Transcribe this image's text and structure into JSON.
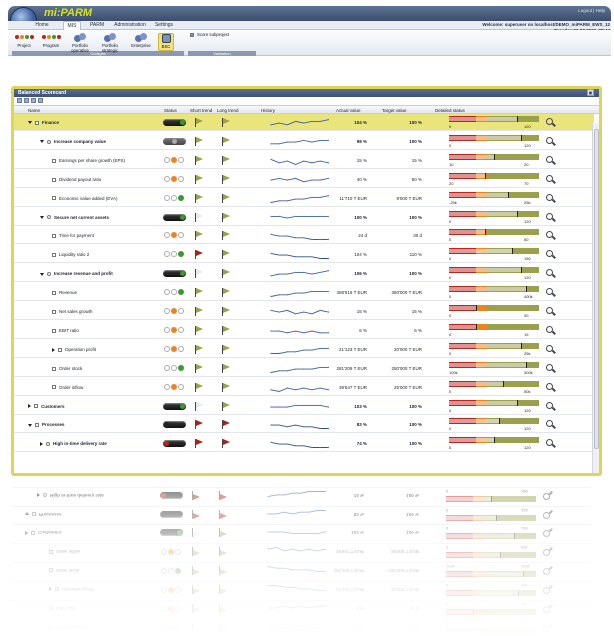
{
  "app": {
    "logo": "mi:PARM",
    "top_links": "Logout | Help"
  },
  "tabs": [
    "Home",
    "MIS",
    "PARM",
    "Administration",
    "Settings"
  ],
  "active_tab": "MIS",
  "welcome": {
    "line1": "Welcome: superuser  on localhost/DEMO_miPARM_EWS_12",
    "line2": "Tuesday 06.03.2012, 08:44"
  },
  "ribbon": {
    "cockpits": [
      "Project",
      "Program",
      "Portfolio operative",
      "Portfolio strategic",
      "Enterprise",
      "BSC"
    ],
    "cockpits_label": "Cockpits",
    "validation_item": "Score subproject",
    "validation_label": "Validation"
  },
  "panel": {
    "title": "Balanced Scorecard"
  },
  "columns": [
    "Name",
    "Status",
    "Short trend",
    "Long trend",
    "History",
    "Actual value",
    "Target value",
    "Detailed status"
  ],
  "rows": [
    {
      "name": "Finance",
      "level": 0,
      "bold": true,
      "hl": true,
      "status": "pill-green",
      "short": "olive",
      "long": "olive",
      "actual": "104 %",
      "target": "100 %",
      "min": "0",
      "max": "120",
      "fill": 0.75,
      "trend": [
        4,
        3,
        4,
        2,
        3,
        2,
        2,
        1
      ]
    },
    {
      "name": "Increase company value",
      "level": 1,
      "bold": true,
      "status": "pill-gray",
      "short": "olive",
      "long": "olive",
      "actual": "98 %",
      "target": "100 %",
      "min": "0",
      "max": "120",
      "fill": 0.8,
      "trend": [
        4,
        4,
        3,
        3,
        2,
        3,
        2,
        2
      ]
    },
    {
      "name": "Earnings per share growth (EPS)",
      "level": 2,
      "status": "lights-orange",
      "short": "olive",
      "long": "olive",
      "actual": "15 %",
      "target": "15 %",
      "min": "10",
      "max": "20",
      "fill": 0.5,
      "trend": [
        2,
        4,
        3,
        5,
        3,
        4,
        3,
        4
      ]
    },
    {
      "name": "Dividend payout ratio",
      "level": 2,
      "status": "lights-orange",
      "short": "olive",
      "long": "olive",
      "actual": "40 %",
      "target": "50 %",
      "min": "20",
      "max": "70",
      "fill": 0.4,
      "trend": [
        3,
        2,
        3,
        2,
        4,
        3,
        3,
        2
      ]
    },
    {
      "name": "Economic value added (EVA)",
      "level": 2,
      "status": "lights-green",
      "short": "olive",
      "long": "olive",
      "actual": "11'710 T EUR",
      "target": "9'000 T EUR",
      "min": "-25k",
      "max": "25k",
      "fill": 0.65,
      "trend": [
        5,
        4,
        4,
        3,
        3,
        2,
        2,
        1
      ]
    },
    {
      "name": "Secure net current assets",
      "level": 1,
      "bold": true,
      "status": "pill-green",
      "short": "outline",
      "long": "olive",
      "actual": "100 %",
      "target": "100 %",
      "min": "0",
      "max": "120",
      "fill": 0.75,
      "trend": [
        2,
        2,
        3,
        2,
        2,
        2,
        2,
        2
      ]
    },
    {
      "name": "Time for payment",
      "level": 2,
      "status": "lights-orange",
      "short": "olive",
      "long": "olive",
      "actual": "24 d",
      "target": "30 d",
      "min": "0",
      "max": "60",
      "fill": 0.4,
      "trend": [
        2,
        3,
        3,
        4,
        4,
        5,
        5,
        5
      ]
    },
    {
      "name": "Liquidity ratio 2",
      "level": 2,
      "status": "lights-green",
      "short": "red",
      "long": "olive",
      "actual": "104 %",
      "target": "110 %",
      "min": "0",
      "max": "150",
      "fill": 0.7,
      "trend": [
        2,
        3,
        3,
        4,
        4,
        4,
        5,
        5
      ]
    },
    {
      "name": "Increase revenue and profit",
      "level": 1,
      "bold": true,
      "status": "pill-green",
      "short": "outline",
      "long": "olive",
      "actual": "106 %",
      "target": "100 %",
      "min": "0",
      "max": "120",
      "fill": 0.8,
      "trend": [
        4,
        3,
        3,
        2,
        2,
        3,
        2,
        1
      ]
    },
    {
      "name": "Revenue",
      "level": 2,
      "status": "lights-green",
      "short": "olive",
      "long": "olive",
      "actual": "368'616 T EUR",
      "target": "360'000 T EUR",
      "min": "0",
      "max": "400k",
      "fill": 0.85,
      "trend": [
        5,
        4,
        4,
        3,
        3,
        2,
        2,
        2
      ]
    },
    {
      "name": "Net sales growth",
      "level": 2,
      "status": "lights-orange",
      "short": "olive",
      "long": "olive",
      "actual": "15 %",
      "target": "15 %",
      "min": "0",
      "max": "30",
      "fill": 0.3,
      "trend": [
        2,
        3,
        2,
        4,
        3,
        4,
        2,
        3
      ]
    },
    {
      "name": "EBIT ratio",
      "level": 2,
      "status": "lights-orange",
      "short": "olive",
      "long": "olive",
      "actual": "6 %",
      "target": "6 %",
      "min": "0",
      "max": "15",
      "fill": 0.3,
      "trend": [
        3,
        3,
        4,
        3,
        4,
        3,
        4,
        4
      ]
    },
    {
      "name": "Operation profit",
      "level": 2,
      "collapsed": true,
      "status": "lights-orange",
      "short": "olive",
      "long": "olive",
      "actual": "21'123 T EUR",
      "target": "20'000 T EUR",
      "min": "0",
      "max": "25k",
      "fill": 0.8,
      "trend": [
        5,
        5,
        4,
        4,
        3,
        3,
        2,
        2
      ]
    },
    {
      "name": "Order stock",
      "level": 2,
      "status": "lights-green",
      "short": "olive",
      "long": "olive",
      "actual": "281'209 T EUR",
      "target": "250'000 T EUR",
      "min": "100k",
      "max": "300k",
      "fill": 0.85,
      "trend": [
        5,
        4,
        4,
        3,
        3,
        3,
        2,
        2
      ]
    },
    {
      "name": "Order inflow",
      "level": 2,
      "status": "lights-orange",
      "short": "olive",
      "long": "olive",
      "actual": "39'647 T EUR",
      "target": "25'000 T EUR",
      "min": "0",
      "max": "50k",
      "fill": 0.6,
      "trend": [
        4,
        5,
        3,
        4,
        3,
        4,
        3,
        4
      ]
    },
    {
      "name": "Customers",
      "level": 0,
      "bold": true,
      "collapsed": true,
      "status": "pill-green",
      "short": "outline",
      "long": "olive",
      "actual": "103 %",
      "target": "100 %",
      "min": "0",
      "max": "120",
      "fill": 0.75,
      "trend": [
        3,
        3,
        3,
        2,
        2,
        2,
        2,
        3
      ]
    },
    {
      "name": "Processes",
      "level": 0,
      "bold": true,
      "status": "pill-dark",
      "short": "red",
      "long": "red",
      "actual": "83 %",
      "target": "100 %",
      "min": "0",
      "max": "120",
      "fill": 0.55,
      "trend": [
        3,
        3,
        4,
        3,
        4,
        4,
        5,
        5
      ]
    },
    {
      "name": "High in-time delivery rate",
      "level": 1,
      "bold": true,
      "collapsed": true,
      "status": "pill-red",
      "short": "red",
      "long": "red",
      "actual": "74 %",
      "target": "100 %",
      "min": "0",
      "max": "120",
      "fill": 0.5,
      "trend": [
        2,
        3,
        3,
        4,
        4,
        5,
        5,
        5
      ]
    }
  ],
  "colors": {
    "panel_border": "#dcd55a",
    "highlight": "#e9e57a",
    "red": "#c0221e",
    "olive": "#9aa04c",
    "green": "#3a9a2c",
    "orange": "#e9841e",
    "navy": "#3c4f74"
  }
}
